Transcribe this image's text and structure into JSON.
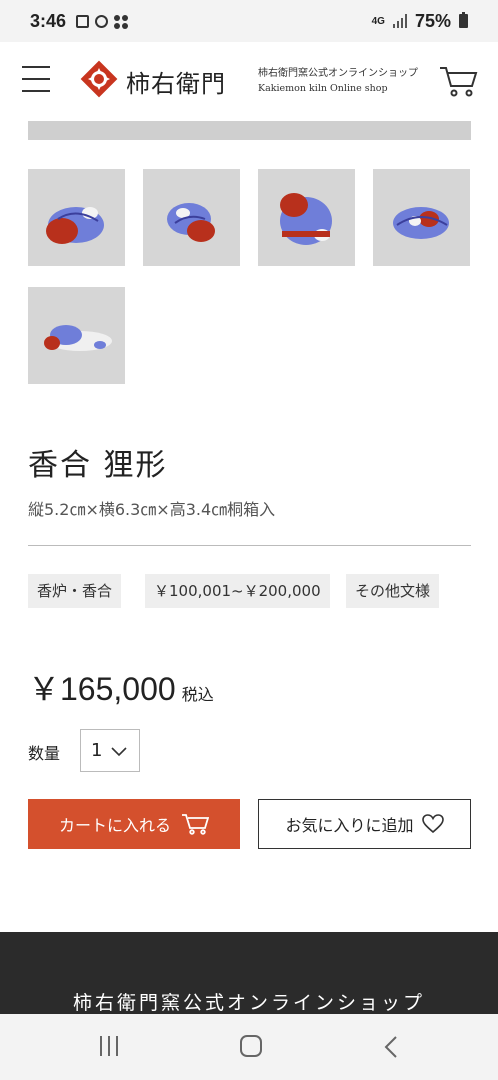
{
  "status": {
    "time": "3:46",
    "network": "4G",
    "battery": "75%"
  },
  "header": {
    "logo_text": "柿右衛門",
    "sub_ja": "柿右衛門窯公式オンラインショップ",
    "sub_en": "Kakiemon kiln Online shop"
  },
  "product": {
    "title": "香合 狸形",
    "dims": "縦5.2㎝×横6.3㎝×高3.4㎝桐箱入",
    "tags": [
      "香炉・香合",
      "￥100,001~￥200,000",
      "その他文様"
    ],
    "price": "￥165,000",
    "tax": "税込",
    "qty_label": "数量",
    "qty_value": "1",
    "add_to_cart": "カートに入れる",
    "add_favorite": "お気に入りに追加"
  },
  "footer": {
    "title": "柿右衛門窯公式オンラインショップ"
  },
  "colors": {
    "accent": "#d4502d",
    "logo_red": "#c8351f",
    "footer_bg": "#2b2b2b"
  },
  "icons": [
    "menu-icon",
    "logo-icon",
    "cart-icon",
    "chevron-down-icon",
    "heart-icon",
    "recents-icon",
    "home-icon",
    "back-icon"
  ]
}
